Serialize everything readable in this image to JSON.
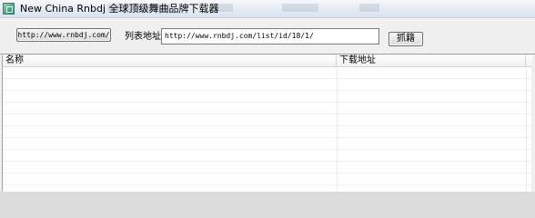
{
  "window": {
    "title": "New China Rnbdj 全球顶级舞曲品牌下载器"
  },
  "toolbar": {
    "site_button_label": "http://www.rnbdj.com/",
    "list_address_label": "列表地址:",
    "list_address_value": "http://www.rnbdj.com/list/id/18/1/",
    "capture_button_label": "抓籍"
  },
  "table": {
    "columns": [
      "名称",
      "下载地址"
    ],
    "rows": []
  }
}
